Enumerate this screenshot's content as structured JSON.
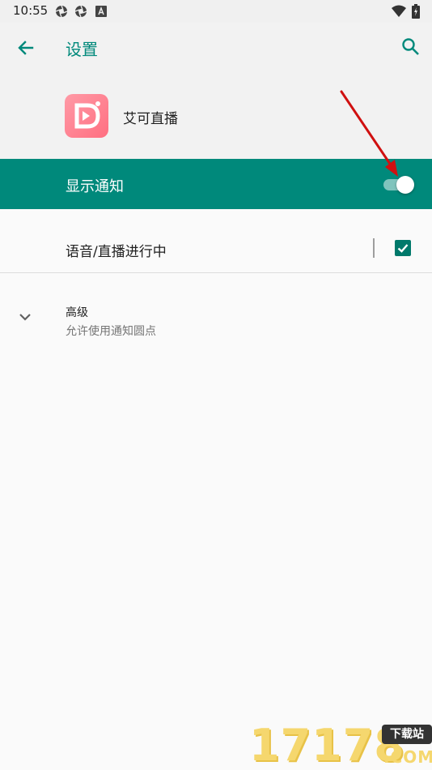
{
  "status_bar": {
    "time": "10:55",
    "icons": [
      "aperture-icon",
      "aperture-icon",
      "a-badge-icon",
      "wifi-icon",
      "battery-charging-icon"
    ]
  },
  "app_bar": {
    "title": "设置",
    "back_icon": "back-arrow-icon",
    "search_icon": "search-icon"
  },
  "app": {
    "name": "艾可直播",
    "icon": "app-logo-icon"
  },
  "show_notifications": {
    "label": "显示通知",
    "enabled": true
  },
  "channel": {
    "label": "语音/直播进行中",
    "checked": true
  },
  "advanced": {
    "title": "高级",
    "subtitle": "允许使用通知圆点"
  },
  "watermark": {
    "number": "17178",
    "badge": "下载站",
    "domain": ".COM"
  },
  "colors": {
    "accent": "#00897b",
    "switch_track": "#80c4bd",
    "annotation_arrow": "#d01010"
  }
}
